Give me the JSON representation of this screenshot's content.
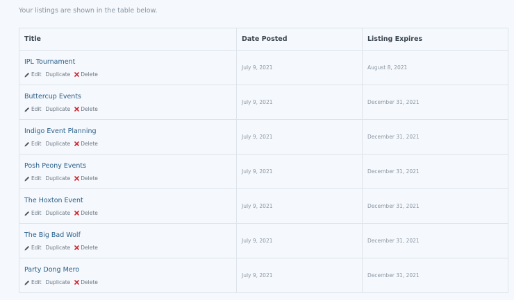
{
  "intro_text": "Your listings are shown in the table below.",
  "table": {
    "headers": {
      "title": "Title",
      "date_posted": "Date Posted",
      "listing_expires": "Listing Expires"
    },
    "action_labels": {
      "edit": "Edit",
      "duplicate": "Duplicate",
      "delete": "Delete"
    },
    "rows": [
      {
        "title": "IPL Tournament",
        "date_posted": "July 9, 2021",
        "listing_expires": "August 8, 2021"
      },
      {
        "title": "Buttercup Events",
        "date_posted": "July 9, 2021",
        "listing_expires": "December 31, 2021"
      },
      {
        "title": "Indigo Event Planning",
        "date_posted": "July 9, 2021",
        "listing_expires": "December 31, 2021"
      },
      {
        "title": "Posh Peony Events",
        "date_posted": "July 9, 2021",
        "listing_expires": "December 31, 2021"
      },
      {
        "title": "The Hoxton Event",
        "date_posted": "July 9, 2021",
        "listing_expires": "December 31, 2021"
      },
      {
        "title": "The Big Bad Wolf",
        "date_posted": "July 9, 2021",
        "listing_expires": "December 31, 2021"
      },
      {
        "title": "Party Dong Mero",
        "date_posted": "July 9, 2021",
        "listing_expires": "December 31, 2021"
      }
    ]
  },
  "colors": {
    "link": "#2a5f8a",
    "delete_icon": "#d0262e",
    "border": "#dde4ea",
    "background": "#f5f8fc"
  },
  "icons": {
    "edit": "pencil-icon",
    "delete": "close-icon"
  }
}
